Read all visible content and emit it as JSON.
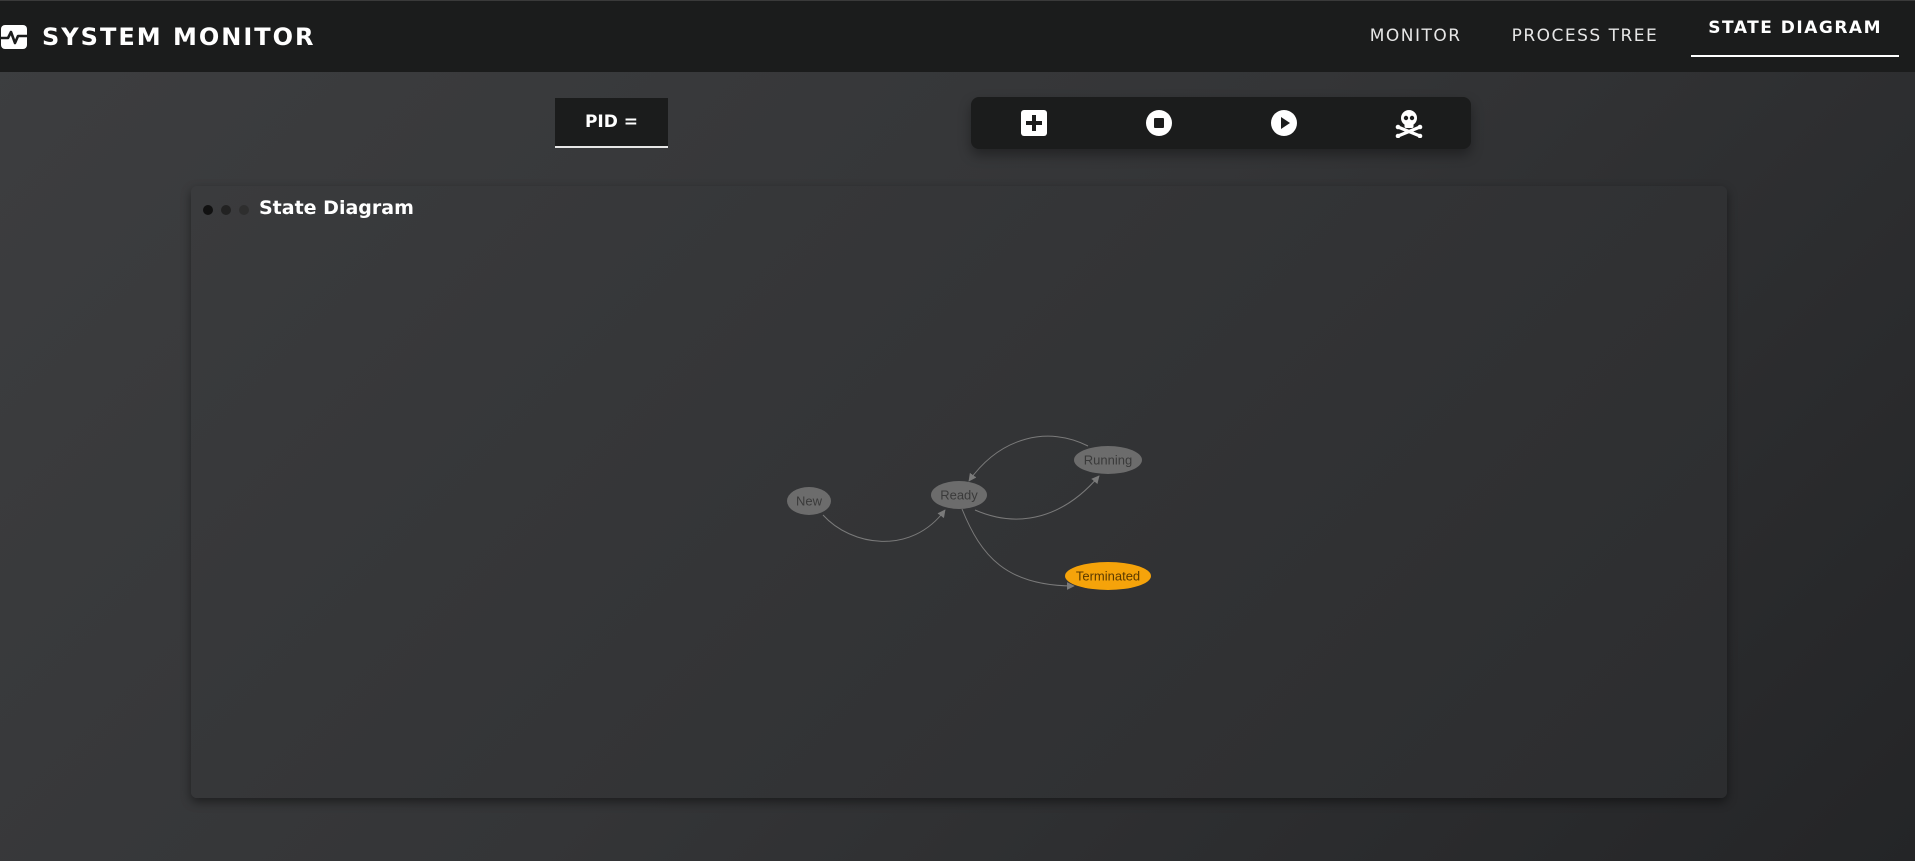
{
  "header": {
    "title": "SYSTEM MONITOR",
    "nav": [
      {
        "label": "MONITOR",
        "active": false
      },
      {
        "label": "PROCESS TREE",
        "active": false
      },
      {
        "label": "STATE DIAGRAM",
        "active": true
      }
    ]
  },
  "pid": {
    "label": "PID ="
  },
  "toolbar": {
    "actions": [
      {
        "name": "add",
        "icon": "plus-square-icon"
      },
      {
        "name": "stop",
        "icon": "stop-circle-icon"
      },
      {
        "name": "play",
        "icon": "play-circle-icon"
      },
      {
        "name": "kill",
        "icon": "skull-crossbones-icon"
      }
    ]
  },
  "card": {
    "title": "State Diagram",
    "dot_colors": [
      "#111111",
      "#222222",
      "#2e2e2e"
    ]
  },
  "diagram": {
    "nodes": [
      {
        "id": "new",
        "label": "New",
        "highlight": false
      },
      {
        "id": "ready",
        "label": "Ready",
        "highlight": false
      },
      {
        "id": "running",
        "label": "Running",
        "highlight": false
      },
      {
        "id": "terminated",
        "label": "Terminated",
        "highlight": true
      }
    ],
    "edges": [
      {
        "from": "New",
        "to": "Ready"
      },
      {
        "from": "Ready",
        "to": "Running"
      },
      {
        "from": "Running",
        "to": "Ready"
      },
      {
        "from": "Ready",
        "to": "Terminated"
      }
    ],
    "colors": {
      "node_fill": "#6c6c6c",
      "node_text": "#3a3a3a",
      "highlight_fill": "#f5a30a",
      "highlight_text": "#5a3a00",
      "edge": "#7a7a7a"
    }
  }
}
